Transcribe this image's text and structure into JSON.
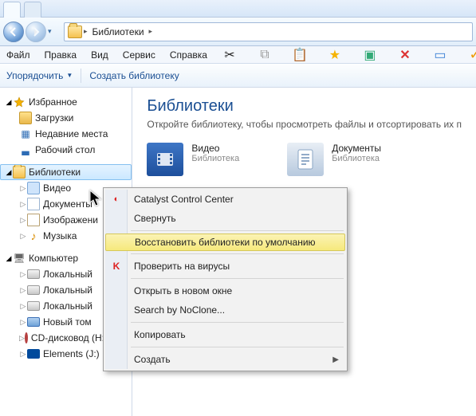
{
  "tabs": [
    {
      "label": ""
    },
    {
      "label": ""
    }
  ],
  "breadcrumb": {
    "root": "Библиотеки"
  },
  "menubar": [
    "Файл",
    "Правка",
    "Вид",
    "Сервис",
    "Справка"
  ],
  "toolbar": {
    "organize": "Упорядочить",
    "new_library": "Создать библиотеку"
  },
  "sidebar": {
    "favorites": {
      "label": "Избранное",
      "items": [
        {
          "icon": "downloads-icon",
          "label": "Загрузки"
        },
        {
          "icon": "recent-places-icon",
          "label": "Недавние места"
        },
        {
          "icon": "desktop-icon",
          "label": "Рабочий стол"
        }
      ]
    },
    "libraries": {
      "label": "Библиотеки",
      "items": [
        {
          "icon": "video-library-icon",
          "label": "Видео"
        },
        {
          "icon": "documents-library-icon",
          "label": "Документы"
        },
        {
          "icon": "pictures-library-icon",
          "label": "Изображени"
        },
        {
          "icon": "music-library-icon",
          "label": "Музыка"
        }
      ]
    },
    "computer": {
      "label": "Компьютер",
      "items": [
        {
          "icon": "local-disk-icon",
          "label": "Локальный"
        },
        {
          "icon": "local-disk-icon",
          "label": "Локальный"
        },
        {
          "icon": "local-disk-icon",
          "label": "Локальный"
        },
        {
          "icon": "local-disk-blue-icon",
          "label": "Новый том"
        },
        {
          "icon": "cd-drive-icon",
          "label": "CD-дисковод (H:) Conne"
        },
        {
          "icon": "wd-drive-icon",
          "label": "Elements (J:)"
        }
      ]
    }
  },
  "content": {
    "title": "Библиотеки",
    "subtitle": "Откройте библиотеку, чтобы просмотреть файлы и отсортировать их п",
    "items": [
      {
        "icon": "video-big-icon",
        "name": "Видео",
        "sub": "Библиотека"
      },
      {
        "icon": "documents-big-icon",
        "name": "Документы",
        "sub": "Библиотека"
      }
    ]
  },
  "context_menu": {
    "items": [
      {
        "label": "Catalyst Control Center",
        "icon": "ccc-icon"
      },
      {
        "label": "Свернуть"
      },
      {
        "sep": true
      },
      {
        "label": "Восстановить библиотеки по умолчанию",
        "highlight": true
      },
      {
        "sep": true
      },
      {
        "label": "Проверить на вирусы",
        "icon": "kaspersky-icon"
      },
      {
        "sep": true
      },
      {
        "label": "Открыть в новом окне"
      },
      {
        "label": "Search by NoClone..."
      },
      {
        "sep": true
      },
      {
        "label": "Копировать"
      },
      {
        "sep": true
      },
      {
        "label": "Создать",
        "submenu": true
      }
    ]
  }
}
